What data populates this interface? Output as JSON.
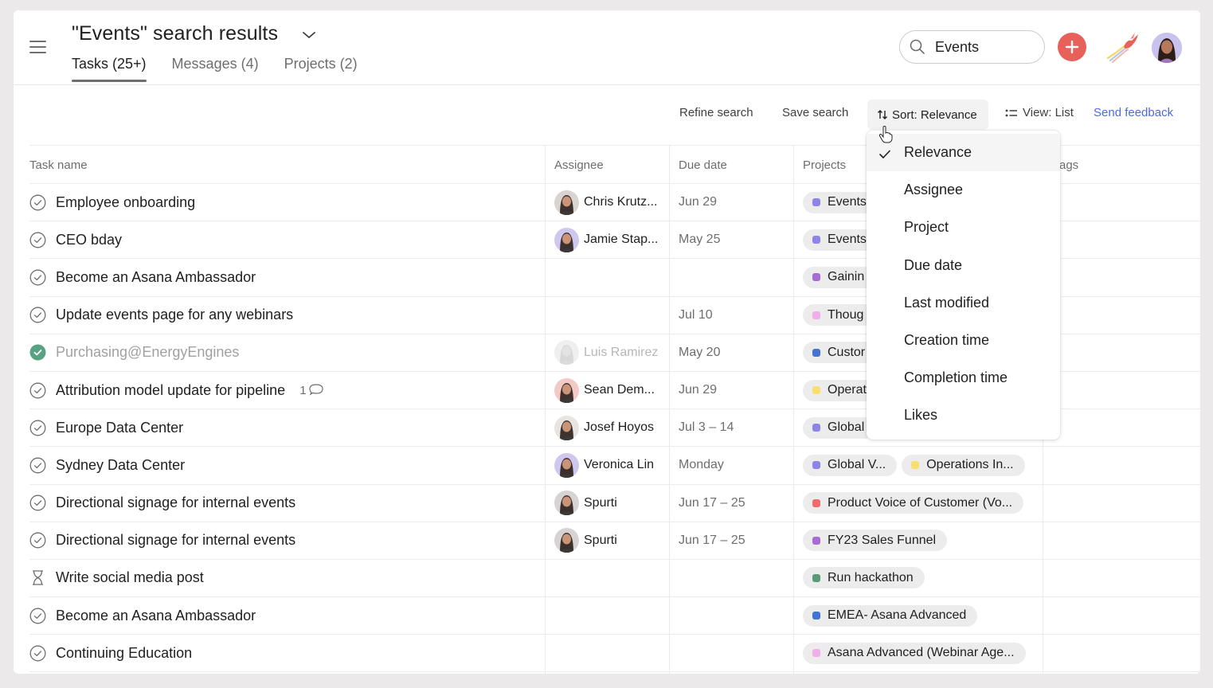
{
  "header": {
    "title": "\"Events\" search results",
    "tabs": [
      {
        "label": "Tasks (25+)",
        "active": true
      },
      {
        "label": "Messages (4)",
        "active": false
      },
      {
        "label": "Projects (2)",
        "active": false
      }
    ],
    "search": {
      "value": "Events",
      "placeholder": "Search"
    },
    "icons": {
      "menu": "hamburger-icon",
      "add": "plus-icon",
      "logo": "phoenix-logo-icon",
      "avatar": "user-avatar"
    }
  },
  "toolbar": {
    "refine": "Refine search",
    "save": "Save search",
    "sort": "Sort: Relevance",
    "view": "View: List",
    "feedback": "Send feedback"
  },
  "columns": {
    "task": "Task name",
    "assignee": "Assignee",
    "due": "Due date",
    "projects": "Projects",
    "tags": "Tags",
    "tags_visible": "ags"
  },
  "sort_menu": {
    "selected": "Relevance",
    "options": [
      "Relevance",
      "Assignee",
      "Project",
      "Due date",
      "Last modified",
      "Creation time",
      "Completion time",
      "Likes"
    ]
  },
  "colors": {
    "accent_red": "#e8605a",
    "link_blue": "#4f6bd7",
    "complete_green": "#58a182"
  },
  "rows": [
    {
      "name": "Employee onboarding",
      "status": "incomplete",
      "assignee": "Chris Krutz...",
      "due": "Jun 29",
      "projects": [
        {
          "label": "Events",
          "color": "#8d84e8"
        }
      ]
    },
    {
      "name": "CEO bday",
      "status": "incomplete",
      "assignee": "Jamie Stap...",
      "due": "May 25",
      "projects": [
        {
          "label": "Events",
          "color": "#8d84e8"
        }
      ]
    },
    {
      "name": "Become an Asana Ambassador",
      "status": "incomplete",
      "assignee": "",
      "due": "",
      "projects": [
        {
          "label": "Gainin",
          "color": "#a66cd3"
        }
      ]
    },
    {
      "name": "Update events page for any webinars",
      "status": "incomplete",
      "assignee": "",
      "due": "Jul 10",
      "projects": [
        {
          "label": "Thoug",
          "color": "#f1aeea"
        }
      ]
    },
    {
      "name": "Purchasing@EnergyEngines",
      "status": "completed",
      "assignee": "Luis Ramirez",
      "due": "May 20",
      "projects": [
        {
          "label": "Custor",
          "color": "#4573d2"
        }
      ]
    },
    {
      "name": "Attribution model update for pipeline",
      "status": "incomplete",
      "comments": "1",
      "assignee": "Sean Dem...",
      "due": "Jun 29",
      "projects": [
        {
          "label": "Operat",
          "color": "#f8df72"
        }
      ]
    },
    {
      "name": "Europe Data Center",
      "status": "incomplete",
      "assignee": "Josef Hoyos",
      "due": "Jul 3 – 14",
      "projects": [
        {
          "label": "Global",
          "color": "#8d84e8"
        }
      ]
    },
    {
      "name": "Sydney Data Center",
      "status": "incomplete",
      "assignee": "Veronica Lin",
      "due": "Monday",
      "projects": [
        {
          "label": "Global V...",
          "color": "#8d84e8"
        },
        {
          "label": "Operations In...",
          "color": "#f8df72"
        }
      ]
    },
    {
      "name": "Directional signage for internal events",
      "status": "incomplete",
      "assignee": "Spurti",
      "due": "Jun 17 – 25",
      "projects": [
        {
          "label": "Product Voice of Customer (Vo...",
          "color": "#f06a6a"
        }
      ]
    },
    {
      "name": "Directional signage for internal events",
      "status": "incomplete",
      "assignee": "Spurti",
      "due": "Jun 17 – 25",
      "projects": [
        {
          "label": "FY23 Sales Funnel",
          "color": "#a66cd3"
        }
      ]
    },
    {
      "name": "Write social media post",
      "status": "pending",
      "assignee": "",
      "due": "",
      "projects": [
        {
          "label": "Run hackathon",
          "color": "#5a9a78"
        }
      ]
    },
    {
      "name": "Become an Asana Ambassador",
      "status": "incomplete",
      "assignee": "",
      "due": "",
      "projects": [
        {
          "label": "EMEA- Asana Advanced",
          "color": "#4573d2"
        }
      ]
    },
    {
      "name": "Continuing Education",
      "status": "incomplete",
      "assignee": "",
      "due": "",
      "projects": [
        {
          "label": "Asana Advanced (Webinar Age...",
          "color": "#f1aeea"
        }
      ]
    }
  ]
}
